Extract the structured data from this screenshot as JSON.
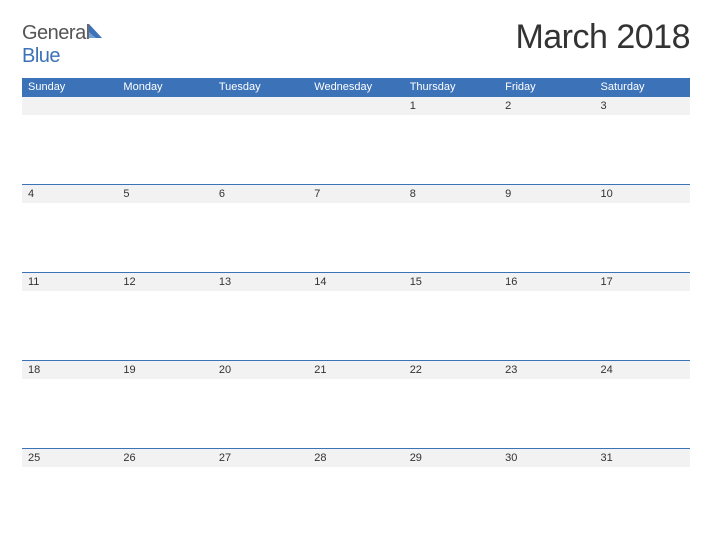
{
  "brand": {
    "word1": "General",
    "word2": "Blue"
  },
  "title": "March 2018",
  "colors": {
    "accent": "#3b72b8",
    "row_band": "#f2f2f2"
  },
  "day_headers": [
    "Sunday",
    "Monday",
    "Tuesday",
    "Wednesday",
    "Thursday",
    "Friday",
    "Saturday"
  ],
  "weeks": [
    [
      "",
      "",
      "",
      "",
      "1",
      "2",
      "3"
    ],
    [
      "4",
      "5",
      "6",
      "7",
      "8",
      "9",
      "10"
    ],
    [
      "11",
      "12",
      "13",
      "14",
      "15",
      "16",
      "17"
    ],
    [
      "18",
      "19",
      "20",
      "21",
      "22",
      "23",
      "24"
    ],
    [
      "25",
      "26",
      "27",
      "28",
      "29",
      "30",
      "31"
    ]
  ]
}
